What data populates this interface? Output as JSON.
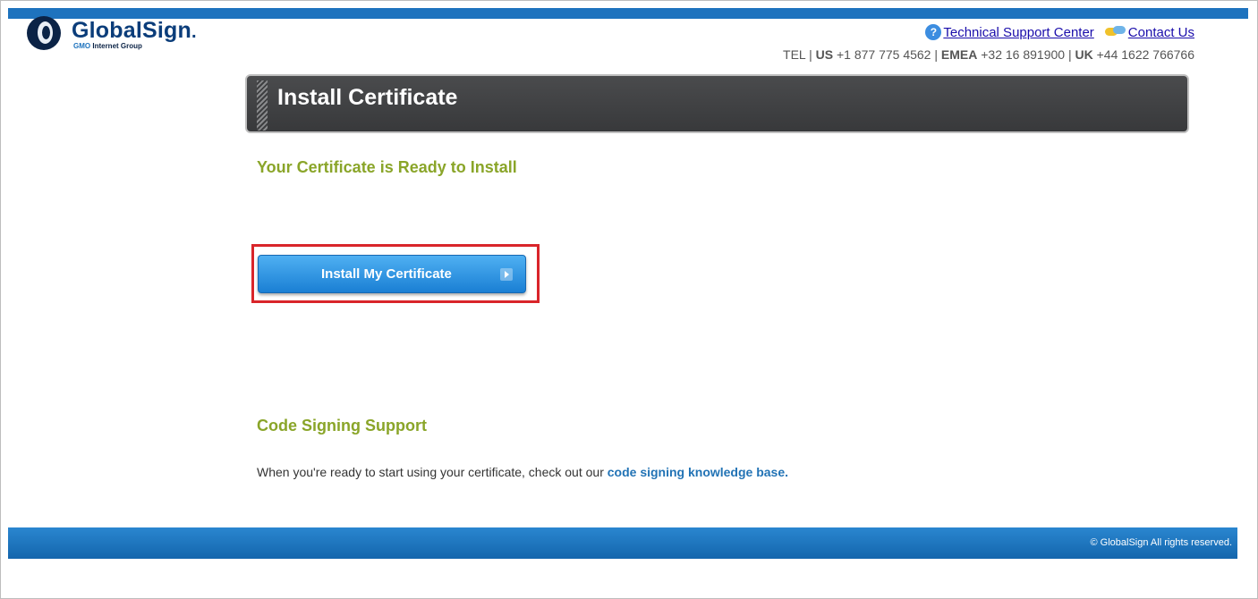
{
  "brand": {
    "name": "GlobalSign",
    "dot": ".",
    "sub_prefix": "GMO",
    "sub_rest": "Internet Group"
  },
  "header_links": {
    "support_center": "Technical Support Center",
    "contact": "Contact Us",
    "help_icon_glyph": "?"
  },
  "phones": {
    "tel_label": "TEL",
    "sep": "|",
    "us_label": "US",
    "us_number": "+1 877 775 4562",
    "emea_label": "EMEA",
    "emea_number": "+32 16 891900",
    "uk_label": "UK",
    "uk_number": "+44 1622 766766"
  },
  "banner": {
    "title": "Install Certificate"
  },
  "main": {
    "ready_heading": "Your Certificate is Ready to Install",
    "install_button_label": "Install My Certificate",
    "support_heading": "Code Signing Support",
    "support_text": "When you're ready to start using your certificate, check out our ",
    "support_link": "code signing knowledge base."
  },
  "footer": {
    "copyright": "© GlobalSign All rights reserved."
  },
  "colors": {
    "brand_blue": "#1e73be",
    "heading_green": "#8aa529",
    "highlight_red": "#d9252a",
    "banner_dark": "#3f4042"
  }
}
